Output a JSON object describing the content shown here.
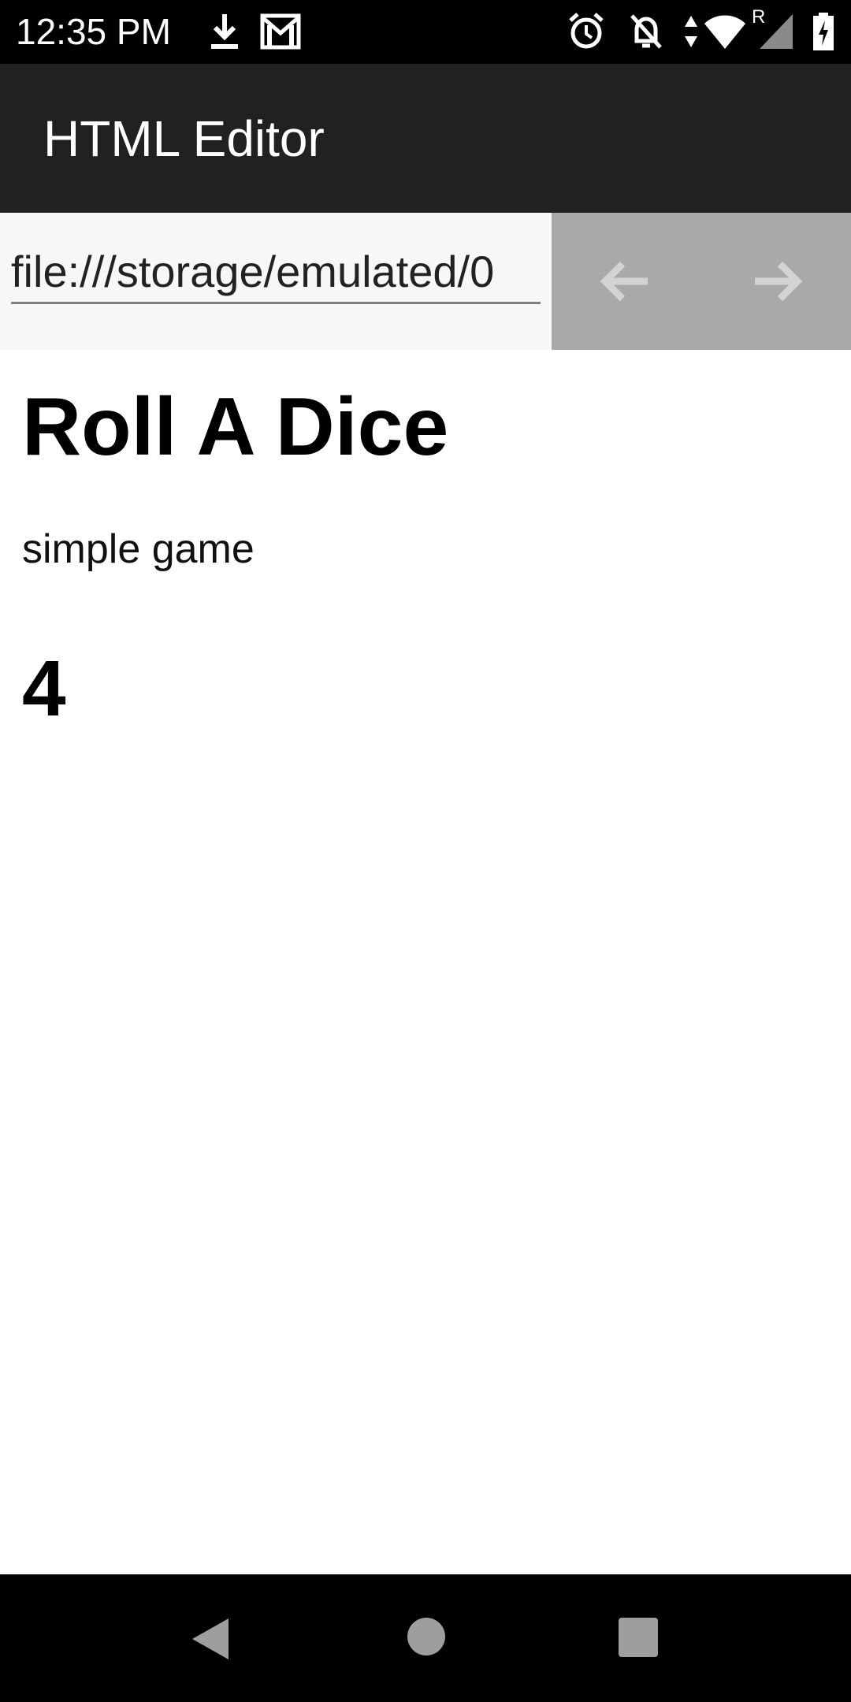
{
  "status_bar": {
    "time": "12:35 PM",
    "icons": [
      "download-icon",
      "gmail-icon",
      "alarm-icon",
      "notifications-off-icon",
      "data-arrows-icon",
      "wifi-icon",
      "signal-icon",
      "battery-charging-icon"
    ],
    "roaming_indicator": "R"
  },
  "app_bar": {
    "title": "HTML Editor"
  },
  "url_bar": {
    "value": "file:///storage/emulated/0",
    "back_icon": "arrow-back-icon",
    "forward_icon": "arrow-forward-icon"
  },
  "page": {
    "heading": "Roll A Dice",
    "paragraph": "simple game",
    "result": "4"
  },
  "nav_bar": {
    "buttons": [
      "back-triangle-icon",
      "home-circle-icon",
      "recents-square-icon"
    ]
  },
  "colors": {
    "status_bar": "#000000",
    "app_bar": "#212121",
    "url_row": "#f7f7f7",
    "nav_panel": "#a9a9a9",
    "nav_arrows": "#d3d3d3",
    "system_nav": "#000000",
    "system_icons": "#9e9e9e"
  }
}
